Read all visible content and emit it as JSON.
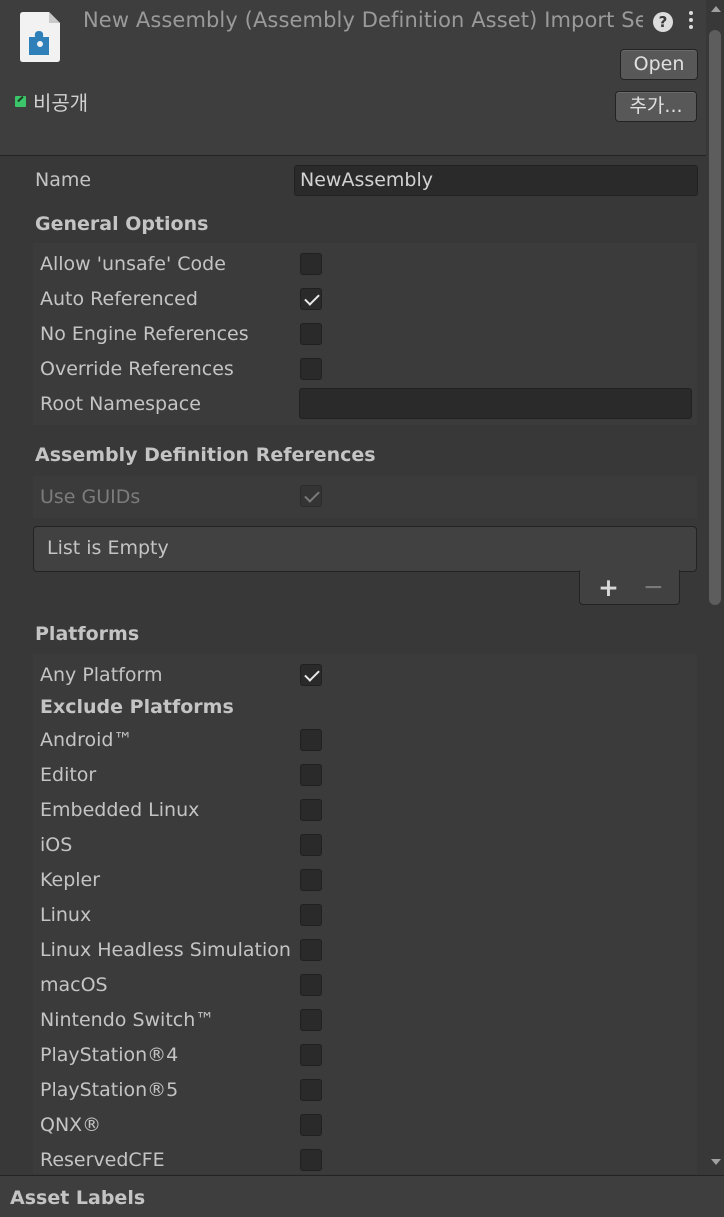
{
  "header": {
    "title": "New Assembly (Assembly Definition Asset) Import Settings",
    "open_label": "Open",
    "add_label": "추가...",
    "private_label": "비공개",
    "icon": "puzzle-asset-icon"
  },
  "name_field": {
    "label": "Name",
    "value": "NewAssembly"
  },
  "general_options": {
    "title": "General Options",
    "allow_unsafe": {
      "label": "Allow 'unsafe' Code",
      "checked": false
    },
    "auto_referenced": {
      "label": "Auto Referenced",
      "checked": true
    },
    "no_engine_refs": {
      "label": "No Engine References",
      "checked": false
    },
    "override_refs": {
      "label": "Override References",
      "checked": false
    },
    "root_namespace": {
      "label": "Root Namespace",
      "value": ""
    }
  },
  "assembly_refs": {
    "title": "Assembly Definition References",
    "use_guids": {
      "label": "Use GUIDs",
      "checked": true
    },
    "list_empty": "List is Empty",
    "add_icon": "+",
    "remove_icon": "−"
  },
  "platforms": {
    "title": "Platforms",
    "any_platform": {
      "label": "Any Platform",
      "checked": true
    },
    "exclude_title": "Exclude Platforms",
    "items": [
      {
        "label": "Android™",
        "checked": false
      },
      {
        "label": "Editor",
        "checked": false
      },
      {
        "label": "Embedded Linux",
        "checked": false
      },
      {
        "label": "iOS",
        "checked": false
      },
      {
        "label": "Kepler",
        "checked": false
      },
      {
        "label": "Linux",
        "checked": false
      },
      {
        "label": "Linux Headless Simulation",
        "checked": false
      },
      {
        "label": "macOS",
        "checked": false
      },
      {
        "label": "Nintendo Switch™",
        "checked": false
      },
      {
        "label": "PlayStation®4",
        "checked": false
      },
      {
        "label": "PlayStation®5",
        "checked": false
      },
      {
        "label": "QNX®",
        "checked": false
      },
      {
        "label": "ReservedCFE",
        "checked": false
      }
    ]
  },
  "footer": {
    "label": "Asset Labels"
  }
}
